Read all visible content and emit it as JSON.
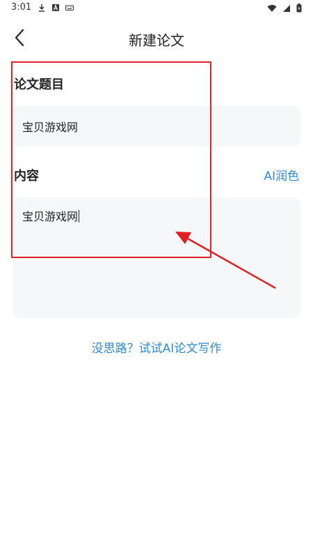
{
  "status_bar": {
    "time": "3:01",
    "left_icons": [
      "download-icon",
      "a-icon",
      "keyboard-icon"
    ],
    "right_icons": [
      "wifi-icon",
      "signal-icon",
      "battery-icon"
    ]
  },
  "header": {
    "title": "新建论文",
    "back_icon": "chevron-left-icon"
  },
  "form": {
    "title_label": "论文题目",
    "title_value": "宝贝游戏网",
    "content_label": "内容",
    "content_value": "宝贝游戏网",
    "ai_polish_label": "AI润色"
  },
  "hint_link": "没思路？试试AI论文写作",
  "colors": {
    "accent": "#2f8ad6",
    "annotation": "#e02020",
    "field_bg": "#f6f7f9"
  }
}
